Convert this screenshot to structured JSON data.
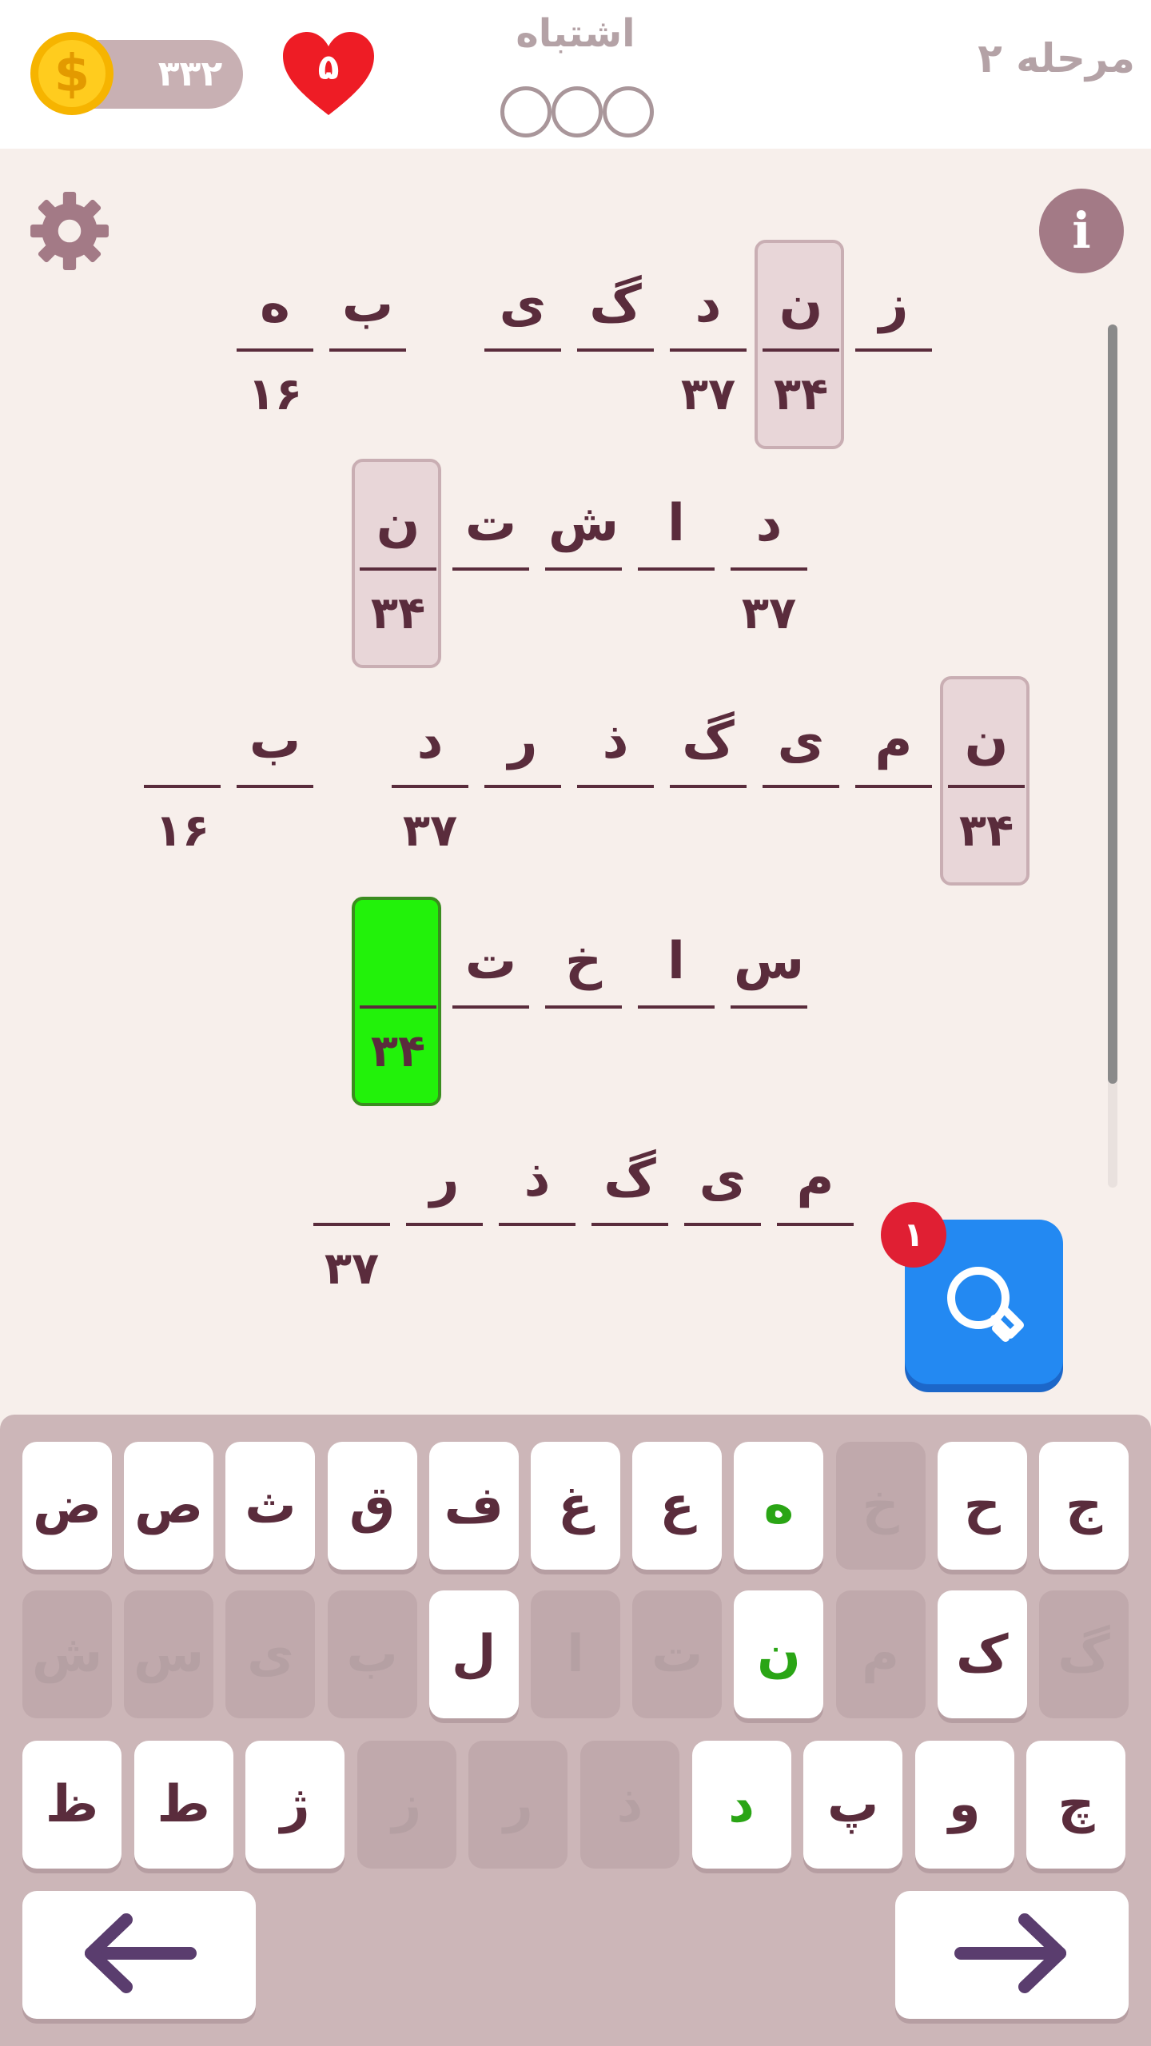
{
  "header": {
    "coins": "۳۳۲",
    "lives": "۵",
    "mistakes_label": "اشتباه",
    "level_label": "مرحله ۲"
  },
  "puzzle": {
    "rows": [
      [
        {
          "letter": "ه",
          "num": "۱۶"
        },
        {
          "letter": "ب",
          "num": ""
        },
        {
          "letter": "ی",
          "num": ""
        },
        {
          "letter": "گ",
          "num": ""
        },
        {
          "letter": "د",
          "num": "۳۷"
        },
        {
          "letter": "ن",
          "num": "۳۴",
          "state": "highlight"
        },
        {
          "letter": "ز",
          "num": ""
        }
      ],
      [
        {
          "letter": "ن",
          "num": "۳۴",
          "state": "highlight"
        },
        {
          "letter": "ت",
          "num": ""
        },
        {
          "letter": "ش",
          "num": ""
        },
        {
          "letter": "ا",
          "num": ""
        },
        {
          "letter": "د",
          "num": "۳۷"
        }
      ],
      [
        {
          "letter": "",
          "num": "۱۶"
        },
        {
          "letter": "ب",
          "num": ""
        },
        {
          "letter": "د",
          "num": "۳۷"
        },
        {
          "letter": "ر",
          "num": ""
        },
        {
          "letter": "ذ",
          "num": ""
        },
        {
          "letter": "گ",
          "num": ""
        },
        {
          "letter": "ی",
          "num": ""
        },
        {
          "letter": "م",
          "num": ""
        },
        {
          "letter": "ن",
          "num": "۳۴",
          "state": "highlight"
        }
      ],
      [
        {
          "letter": "",
          "num": "۳۴",
          "state": "active"
        },
        {
          "letter": "ت",
          "num": ""
        },
        {
          "letter": "خ",
          "num": ""
        },
        {
          "letter": "ا",
          "num": ""
        },
        {
          "letter": "س",
          "num": ""
        }
      ],
      [
        {
          "letter": "",
          "num": "۳۷"
        },
        {
          "letter": "ر",
          "num": ""
        },
        {
          "letter": "ذ",
          "num": ""
        },
        {
          "letter": "گ",
          "num": ""
        },
        {
          "letter": "ی",
          "num": ""
        },
        {
          "letter": "م",
          "num": ""
        }
      ]
    ]
  },
  "hint": {
    "count": "۱"
  },
  "keyboard": {
    "row1": [
      {
        "char": "ض",
        "state": "normal"
      },
      {
        "char": "ص",
        "state": "normal"
      },
      {
        "char": "ث",
        "state": "normal"
      },
      {
        "char": "ق",
        "state": "normal"
      },
      {
        "char": "ف",
        "state": "normal"
      },
      {
        "char": "غ",
        "state": "normal"
      },
      {
        "char": "ع",
        "state": "normal"
      },
      {
        "char": "ه",
        "state": "correct"
      },
      {
        "char": "خ",
        "state": "disabled"
      },
      {
        "char": "ح",
        "state": "normal"
      },
      {
        "char": "ج",
        "state": "normal"
      }
    ],
    "row2": [
      {
        "char": "ش",
        "state": "disabled"
      },
      {
        "char": "س",
        "state": "disabled"
      },
      {
        "char": "ی",
        "state": "disabled"
      },
      {
        "char": "ب",
        "state": "disabled"
      },
      {
        "char": "ل",
        "state": "normal"
      },
      {
        "char": "ا",
        "state": "disabled"
      },
      {
        "char": "ت",
        "state": "disabled"
      },
      {
        "char": "ن",
        "state": "correct"
      },
      {
        "char": "م",
        "state": "disabled"
      },
      {
        "char": "ک",
        "state": "normal"
      },
      {
        "char": "گ",
        "state": "disabled"
      }
    ],
    "row3": [
      {
        "char": "ظ",
        "state": "normal"
      },
      {
        "char": "ط",
        "state": "normal"
      },
      {
        "char": "ژ",
        "state": "normal"
      },
      {
        "char": "ز",
        "state": "disabled"
      },
      {
        "char": "ر",
        "state": "disabled"
      },
      {
        "char": "ذ",
        "state": "disabled"
      },
      {
        "char": "د",
        "state": "correct"
      },
      {
        "char": "پ",
        "state": "normal"
      },
      {
        "char": "و",
        "state": "normal"
      },
      {
        "char": "چ",
        "state": "normal"
      }
    ]
  },
  "icons": {
    "coin": "dollar-coin-icon",
    "heart": "heart-icon",
    "settings": "gear-icon",
    "info": "info-icon",
    "hint": "lightbulb-icon",
    "left": "arrow-left-icon",
    "right": "arrow-right-icon"
  }
}
